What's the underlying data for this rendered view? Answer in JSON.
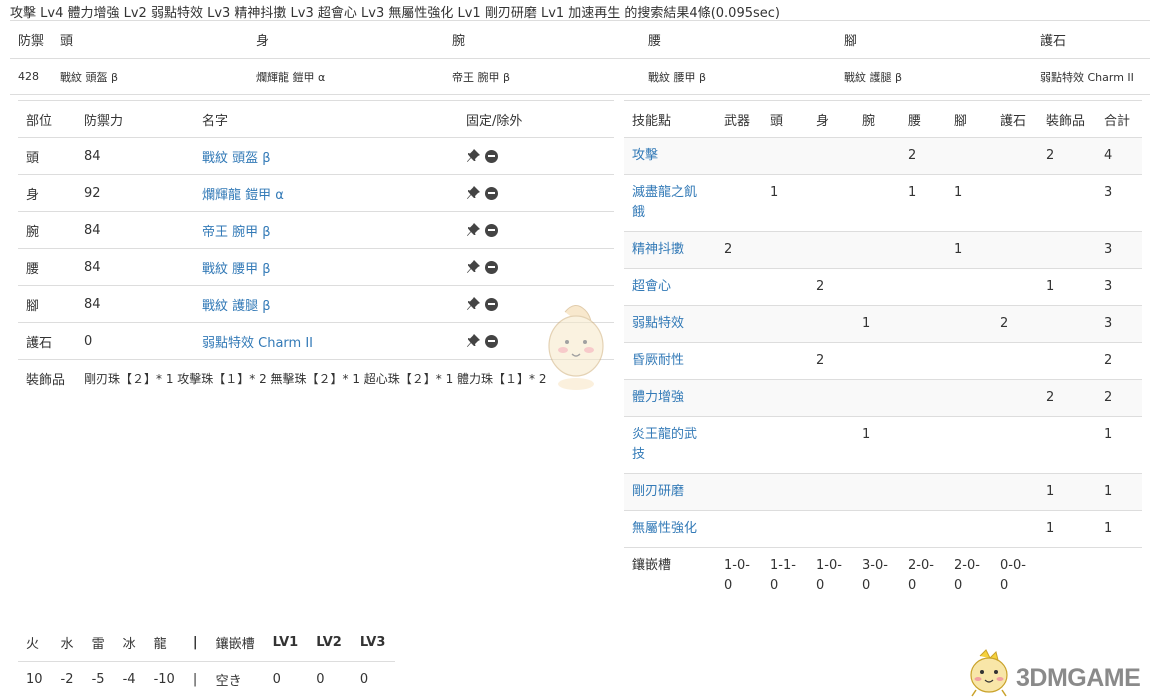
{
  "search_title": "攻擊 Lv4 體力增強 Lv2 弱點特效 Lv3 精神抖擻 Lv3 超會心 Lv3 無屬性強化 Lv1 剛刃研磨 Lv1 加速再生 的搜索結果4條(0.095sec)",
  "result": {
    "headers": [
      "防禦",
      "頭",
      "身",
      "腕",
      "腰",
      "腳",
      "護石"
    ],
    "row": [
      "428",
      "戰紋 頭盔 β",
      "爛輝龍 鎧甲 α",
      "帝王 腕甲 β",
      "戰紋 腰甲 β",
      "戰紋 護腿 β",
      "弱點特效 Charm II"
    ]
  },
  "equipment": {
    "headers": [
      "部位",
      "防禦力",
      "名字",
      "固定/除外"
    ],
    "rows": [
      {
        "part": "頭",
        "defense": "84",
        "name": "戰紋 頭盔 β"
      },
      {
        "part": "身",
        "defense": "92",
        "name": "爛輝龍 鎧甲 α"
      },
      {
        "part": "腕",
        "defense": "84",
        "name": "帝王 腕甲 β"
      },
      {
        "part": "腰",
        "defense": "84",
        "name": "戰紋 腰甲 β"
      },
      {
        "part": "腳",
        "defense": "84",
        "name": "戰紋 護腿 β"
      },
      {
        "part": "護石",
        "defense": "0",
        "name": "弱點特效 Charm II"
      }
    ],
    "deco_label": "裝飾品",
    "deco_value": "剛刃珠【２】* 1 攻擊珠【１】* 2 無擊珠【２】* 1 超心珠【２】* 1 體力珠【１】* 2"
  },
  "skills": {
    "headers": [
      "技能點",
      "武器",
      "頭",
      "身",
      "腕",
      "腰",
      "腳",
      "護石",
      "裝飾品",
      "合計"
    ],
    "rows": [
      {
        "name": "攻擊",
        "cells": [
          "",
          "",
          "",
          "",
          "2",
          "",
          "",
          "2",
          "4"
        ]
      },
      {
        "name": "滅盡龍之飢餓",
        "cells": [
          "",
          "1",
          "",
          "",
          "1",
          "1",
          "",
          "",
          "3"
        ]
      },
      {
        "name": "精神抖擻",
        "cells": [
          "2",
          "",
          "",
          "",
          "",
          "1",
          "",
          "",
          "3"
        ]
      },
      {
        "name": "超會心",
        "cells": [
          "",
          "",
          "2",
          "",
          "",
          "",
          "",
          "1",
          "3"
        ]
      },
      {
        "name": "弱點特效",
        "cells": [
          "",
          "",
          "",
          "1",
          "",
          "",
          "2",
          "",
          "3"
        ]
      },
      {
        "name": "昏厥耐性",
        "cells": [
          "",
          "",
          "2",
          "",
          "",
          "",
          "",
          "",
          "2"
        ]
      },
      {
        "name": "體力增強",
        "cells": [
          "",
          "",
          "",
          "",
          "",
          "",
          "",
          "2",
          "2"
        ]
      },
      {
        "name": "炎王龍的武技",
        "cells": [
          "",
          "",
          "",
          "1",
          "",
          "",
          "",
          "",
          "1"
        ]
      },
      {
        "name": "剛刃研磨",
        "cells": [
          "",
          "",
          "",
          "",
          "",
          "",
          "",
          "1",
          "1"
        ]
      },
      {
        "name": "無屬性強化",
        "cells": [
          "",
          "",
          "",
          "",
          "",
          "",
          "",
          "1",
          "1"
        ]
      }
    ],
    "slot_label": "鑲嵌槽",
    "slots": [
      "1-0-0",
      "1-1-0",
      "1-0-0",
      "3-0-0",
      "2-0-0",
      "2-0-0",
      "0-0-0"
    ]
  },
  "resist": {
    "headers": [
      "火",
      "水",
      "雷",
      "冰",
      "龍",
      "|",
      "鑲嵌槽",
      "LV1",
      "LV2",
      "LV3"
    ],
    "values": [
      "10",
      "-2",
      "-5",
      "-4",
      "-10",
      "|",
      "空き",
      "0",
      "0",
      "0"
    ]
  },
  "watermark": "3DMGAME",
  "icons": {
    "fix": "pin-icon",
    "exclude": "minus-circle-icon"
  },
  "colors": {
    "link": "#337ab7",
    "stripe": "#f9f9f9",
    "border": "#dddddd"
  }
}
